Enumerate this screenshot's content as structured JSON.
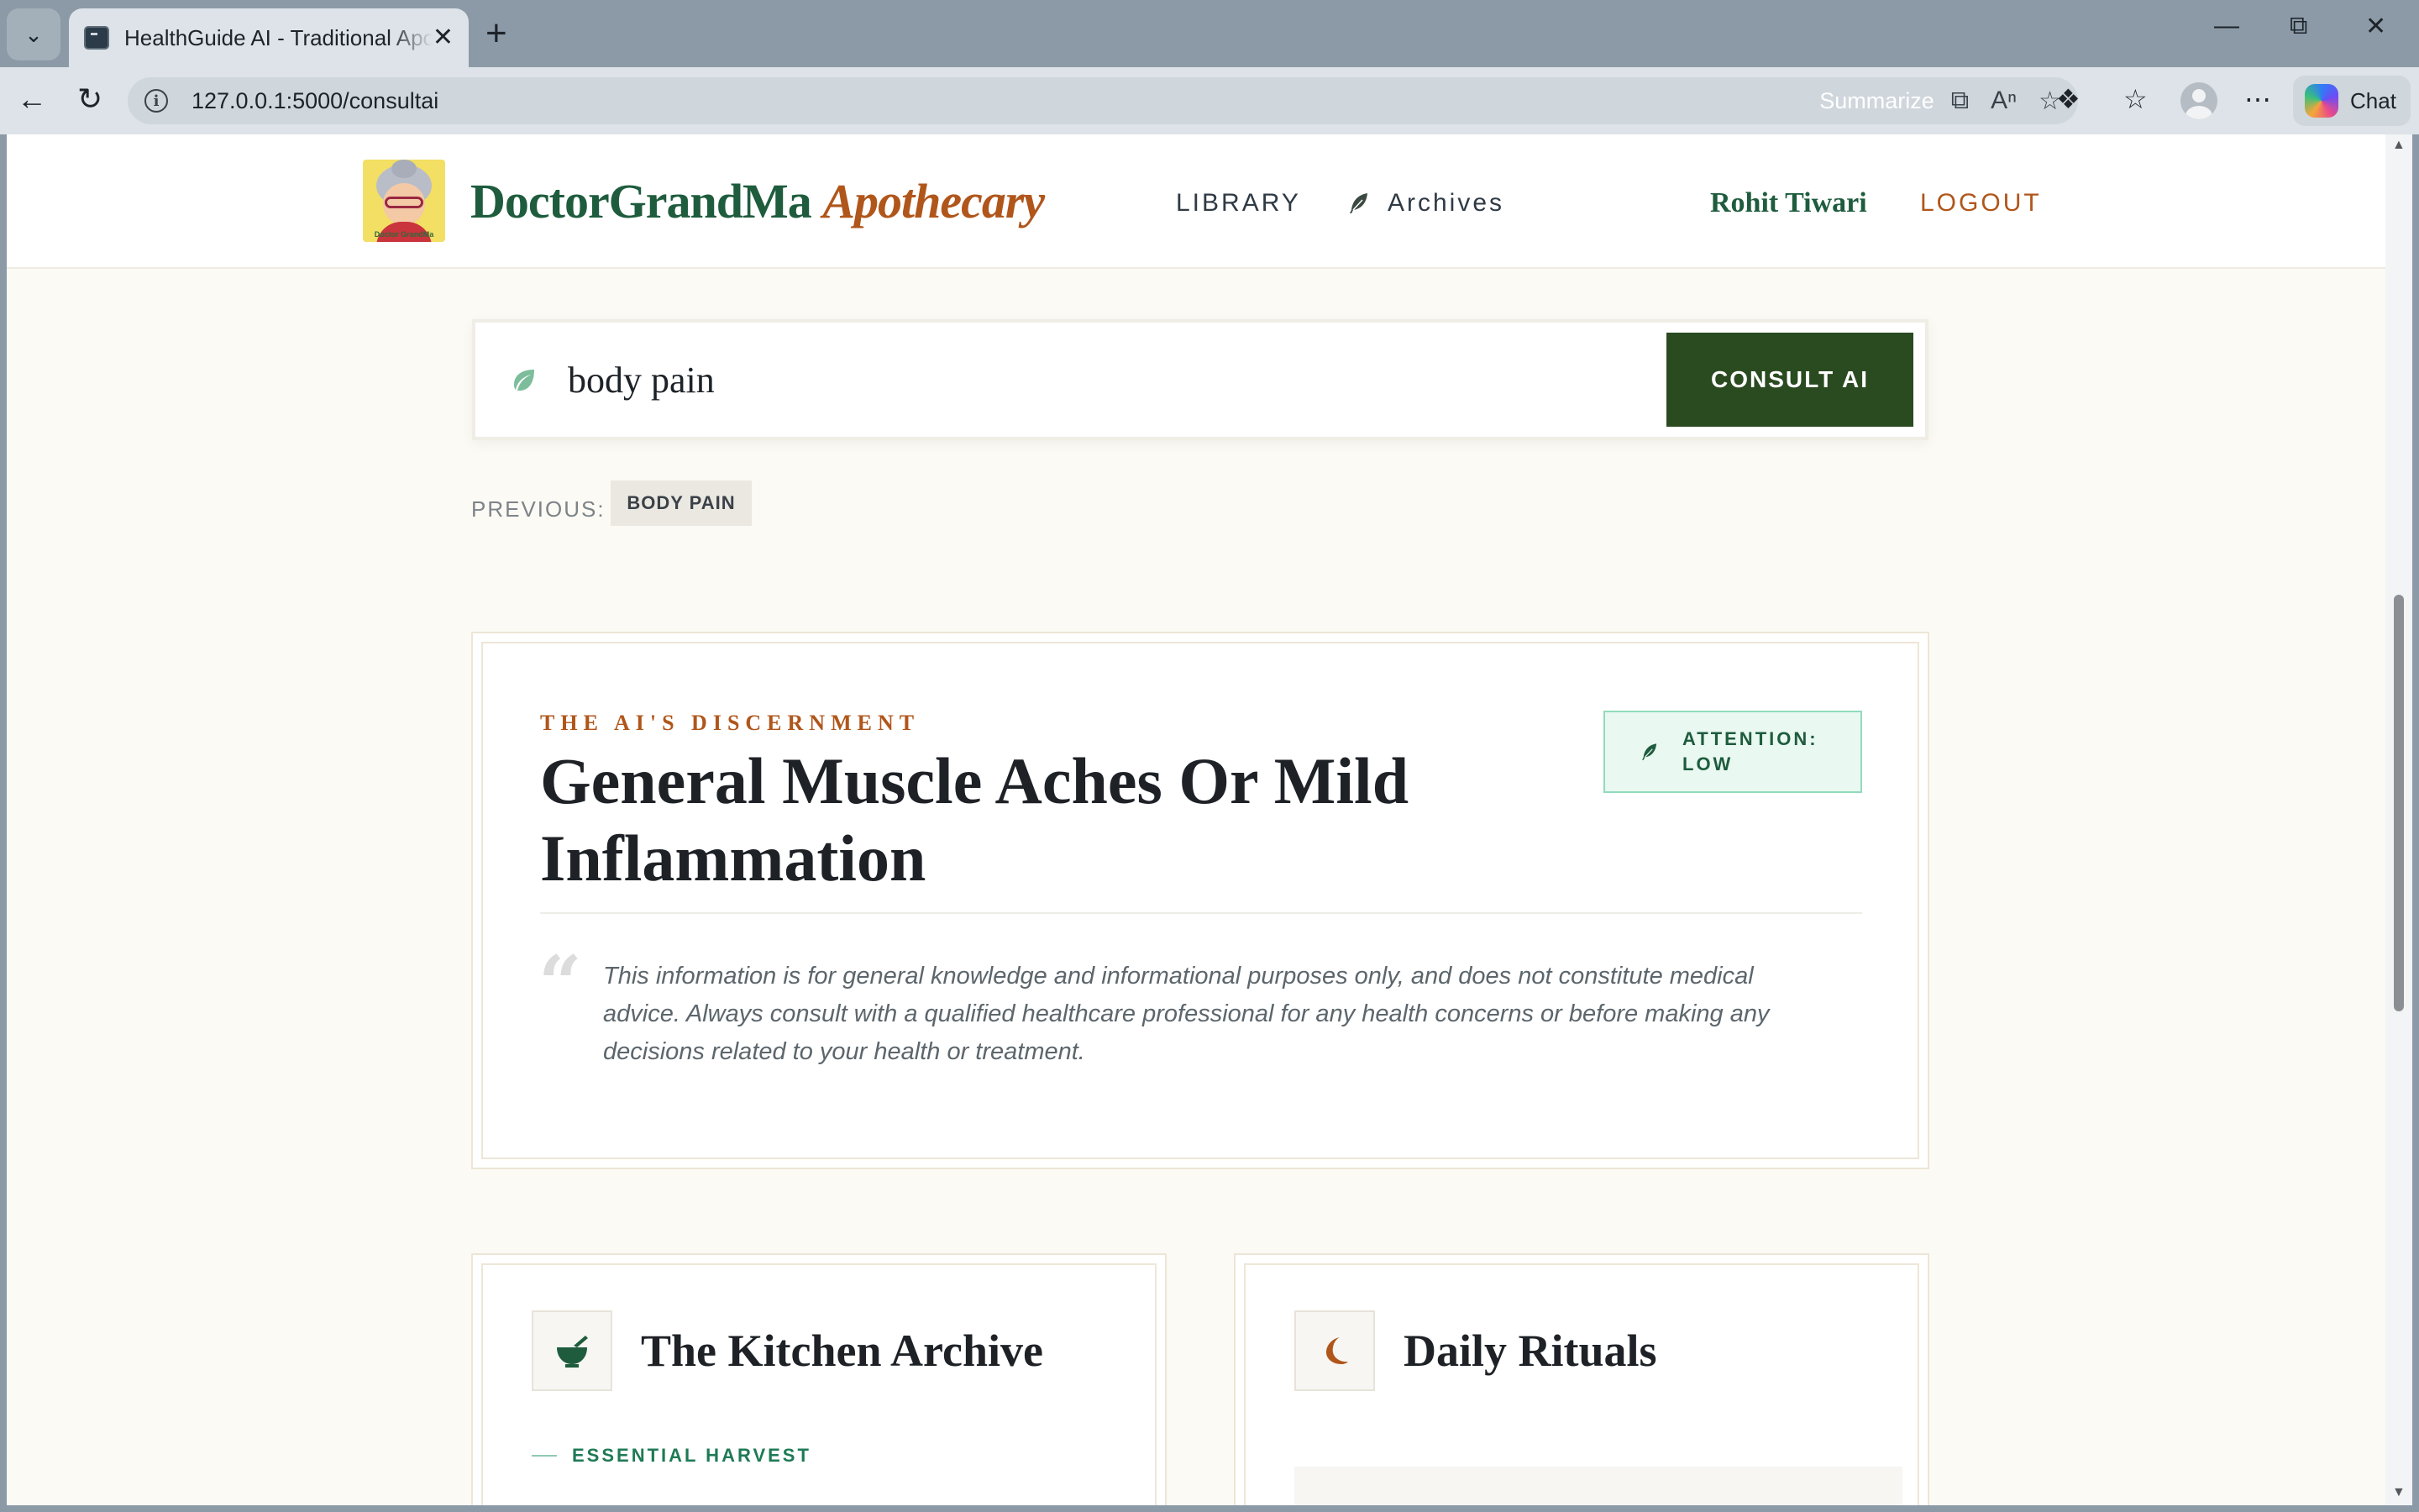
{
  "browser": {
    "tab_title": "HealthGuide AI - Traditional Apothecary",
    "url": "127.0.0.1:5000/consultai",
    "summarize_label": "Summarize",
    "chat_label": "Chat"
  },
  "header": {
    "brand_primary": "DoctorGrandMa",
    "brand_accent": "Apothecary",
    "logo_caption": "Doctor GrandMa",
    "nav": {
      "library": "LIBRARY",
      "archives": "Archives"
    },
    "user_name": "Rohit Tiwari",
    "logout": "LOGOUT"
  },
  "search": {
    "value": "body pain",
    "button_label": "CONSULT AI",
    "previous_label": "PREVIOUS:",
    "previous_items": [
      "BODY PAIN"
    ]
  },
  "result": {
    "kicker": "THE AI'S DISCERNMENT",
    "title": "General Muscle Aches Or Mild Inflammation",
    "attention": "ATTENTION: LOW",
    "disclaimer": "This information is for general knowledge and informational purposes only, and does not constitute medical advice. Always consult with a qualified healthcare professional for any health concerns or before making any decisions related to your health or treatment."
  },
  "cards": {
    "kitchen": {
      "title": "The Kitchen Archive",
      "subtitle": "ESSENTIAL HARVEST"
    },
    "rituals": {
      "title": "Daily Rituals"
    }
  },
  "colors": {
    "brand_green": "#1e5c3d",
    "brand_orange": "#b0561b",
    "button_green": "#2a4a20",
    "badge_bg": "#e9f8f1",
    "page_bg": "#fcfaf4"
  },
  "icons": {
    "search_leaf": "leaf-icon",
    "archives": "feather-icon",
    "kitchen": "mortar-pestle-icon",
    "rituals": "moon-icon",
    "quote": "quote-icon"
  }
}
